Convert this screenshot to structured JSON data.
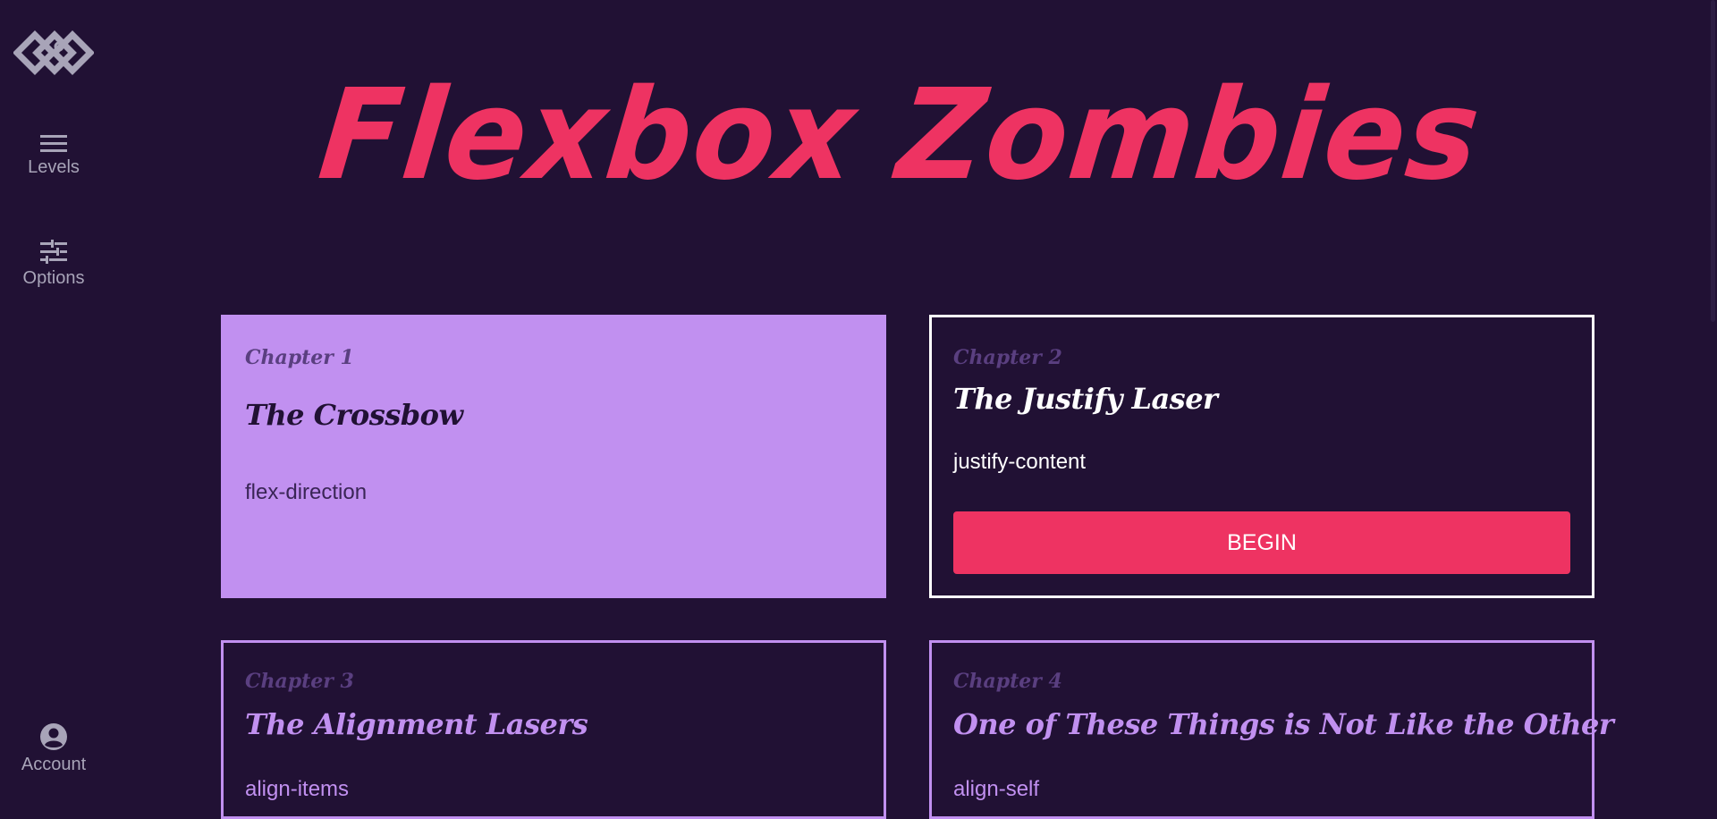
{
  "sidebar": {
    "levels_label": "Levels",
    "options_label": "Options",
    "account_label": "Account"
  },
  "title": "Flexbox Zombies",
  "chapters": [
    {
      "chapter": "Chapter 1",
      "name": "The Crossbow",
      "property": "flex-direction"
    },
    {
      "chapter": "Chapter 2",
      "name": "The Justify Laser",
      "property": "justify-content",
      "button": "BEGIN"
    },
    {
      "chapter": "Chapter 3",
      "name": "The Alignment Lasers",
      "property": "align-items"
    },
    {
      "chapter": "Chapter 4",
      "name": "One of These Things is Not Like the Other",
      "property": "align-self"
    }
  ],
  "colors": {
    "background": "#211134",
    "accent": "#ee3362",
    "lavender": "#c190f0"
  }
}
